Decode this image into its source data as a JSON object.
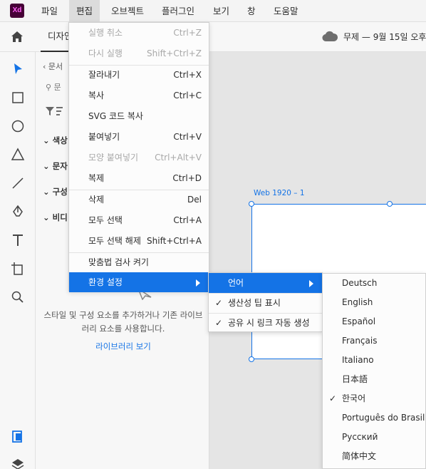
{
  "app": {
    "logo": "Xd"
  },
  "menubar": {
    "items": [
      "파일",
      "편집",
      "오브젝트",
      "플러그인",
      "보기",
      "창",
      "도움말"
    ]
  },
  "toolbar": {
    "mode_tab": "디자인",
    "document_title": "무제 — 9월 15일 오후"
  },
  "assets_panel": {
    "back_label": "문서",
    "search_placeholder": "문",
    "sections": [
      "색상",
      "문자",
      "구성",
      "비디"
    ],
    "empty_message": "스타일 및 구성 요소를 추가하거나 기존 라이브러리 요소를 사용합니다.",
    "library_link": "라이브러리 보기"
  },
  "canvas": {
    "artboard_label": "Web 1920 – 1"
  },
  "edit_menu": {
    "items": [
      {
        "label": "실행 취소",
        "shortcut": "Ctrl+Z",
        "disabled": true
      },
      {
        "label": "다시 실행",
        "shortcut": "Shift+Ctrl+Z",
        "disabled": true
      },
      {
        "label": "잘라내기",
        "shortcut": "Ctrl+X"
      },
      {
        "label": "복사",
        "shortcut": "Ctrl+C"
      },
      {
        "label": "SVG 코드 복사",
        "shortcut": ""
      },
      {
        "label": "붙여넣기",
        "shortcut": "Ctrl+V"
      },
      {
        "label": "모양 붙여넣기",
        "shortcut": "Ctrl+Alt+V",
        "disabled": true
      },
      {
        "label": "복제",
        "shortcut": "Ctrl+D"
      },
      {
        "label": "삭제",
        "shortcut": "Del"
      },
      {
        "label": "모두 선택",
        "shortcut": "Ctrl+A"
      },
      {
        "label": "모두 선택 해제",
        "shortcut": "Shift+Ctrl+A"
      },
      {
        "label": "맞춤법 검사 켜기",
        "shortcut": ""
      },
      {
        "label": "환경 설정",
        "shortcut": "",
        "highlighted": true
      }
    ]
  },
  "preferences_menu": {
    "items": [
      {
        "label": "언어",
        "highlighted": true
      },
      {
        "label": "생산성 팁 표시",
        "checked": true
      },
      {
        "label": "공유 시 링크 자동 생성",
        "checked": true
      }
    ]
  },
  "language_menu": {
    "items": [
      {
        "label": "Deutsch"
      },
      {
        "label": "English"
      },
      {
        "label": "Español"
      },
      {
        "label": "Français"
      },
      {
        "label": "Italiano"
      },
      {
        "label": "日本語"
      },
      {
        "label": "한국어",
        "checked": true
      },
      {
        "label": "Português do Brasil"
      },
      {
        "label": "Русский"
      },
      {
        "label": "简体中文"
      }
    ]
  },
  "colors": {
    "accent": "#1473e6",
    "logo_bg": "#470137",
    "logo_fg": "#ff61f6"
  }
}
